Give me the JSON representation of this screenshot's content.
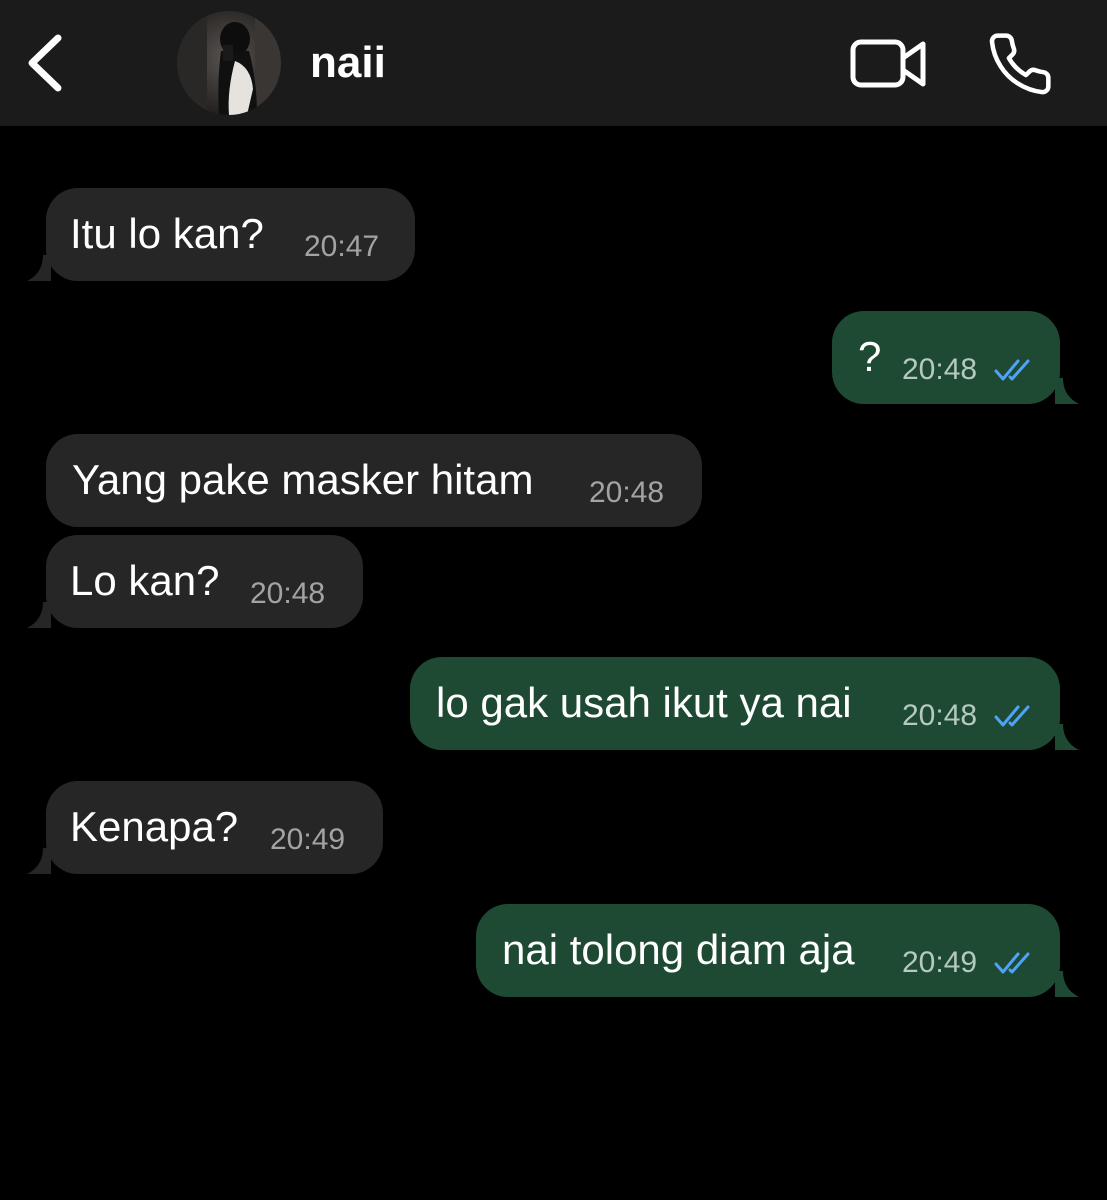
{
  "header": {
    "contact_name": "naii",
    "back_icon": "chevron-left-icon",
    "video_icon": "video-camera-icon",
    "call_icon": "phone-icon"
  },
  "colors": {
    "header_bg": "#1b1b1b",
    "incoming_bubble": "#262626",
    "outgoing_bubble": "#1e4a33",
    "read_ticks": "#4fa3f7",
    "timestamp": "#a3a3a3"
  },
  "messages": [
    {
      "direction": "incoming",
      "text": "Itu lo kan?",
      "time": "20:47"
    },
    {
      "direction": "outgoing",
      "text": "?",
      "time": "20:48",
      "status": "read"
    },
    {
      "direction": "incoming",
      "text": "Yang pake masker hitam",
      "time": "20:48"
    },
    {
      "direction": "incoming",
      "text": "Lo kan?",
      "time": "20:48"
    },
    {
      "direction": "outgoing",
      "text": "lo gak usah ikut ya nai",
      "time": "20:48",
      "status": "read"
    },
    {
      "direction": "incoming",
      "text": "Kenapa?",
      "time": "20:49"
    },
    {
      "direction": "outgoing",
      "text": "nai tolong diam aja",
      "time": "20:49",
      "status": "read"
    }
  ]
}
